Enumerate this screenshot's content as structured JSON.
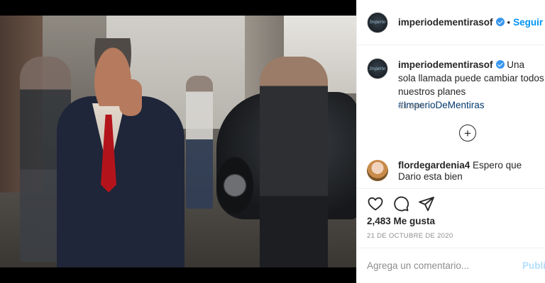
{
  "post": {
    "username": "imperiodementirasof",
    "follow_label": "Seguir",
    "separator": "•",
    "avatar_text": "Imperio",
    "caption_text": "Una sola llamada puede cambiar todos nuestros planes",
    "caption_hashtag": "#ImperioDeMentiras",
    "time_ago": "11 sem",
    "likes": "2,483 Me gusta",
    "date": "21 DE OCTUBRE DE 2020"
  },
  "comments": [
    {
      "username": "flordegardenia4",
      "text": "Espero que Dario esta bien"
    }
  ],
  "add_comment": {
    "placeholder": "Agrega un comentario...",
    "post_label": "Publicar"
  },
  "colors": {
    "link_blue": "#0095f6",
    "verified_blue": "#3897f0",
    "hashtag": "#00376b",
    "secondary_text": "#8e8e8e"
  }
}
